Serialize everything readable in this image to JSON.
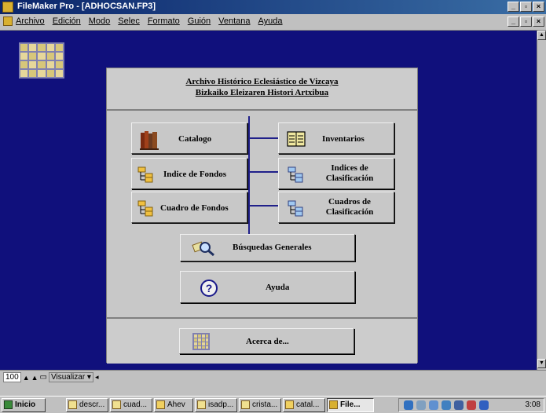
{
  "window": {
    "title": "FileMaker Pro - [ADHOCSAN.FP3]"
  },
  "menu": {
    "items": [
      "Archivo",
      "Edición",
      "Modo",
      "Selec",
      "Formato",
      "Guión",
      "Ventana",
      "Ayuda"
    ]
  },
  "header": {
    "line1": "Archivo Histórico Eclesiástico de Vizcaya",
    "line2": "Bizkaiko Eleizaren Histori Artxibua"
  },
  "buttons": {
    "catalogo": "Catalogo",
    "inventarios": "Inventarios",
    "indice_fondos": "Indice de Fondos",
    "indices_clasif_1": "Indices de",
    "indices_clasif_2": "Clasificación",
    "cuadro_fondos": "Cuadro de Fondos",
    "cuadros_clasif_1": "Cuadros de",
    "cuadros_clasif_2": "Clasificación",
    "busquedas": "Búsquedas Generales",
    "ayuda": "Ayuda",
    "acerca": "Acerca de..."
  },
  "icons": {
    "catalogo": "books-icon",
    "inventarios": "ledger-icon",
    "folders": "folder-tree-icon",
    "busquedas": "magnifier-icon",
    "ayuda": "question-mark-icon",
    "acerca": "grid-icon"
  },
  "statusbar": {
    "zoom": "100",
    "view_label": "Visualizar"
  },
  "taskbar": {
    "start": "Inicio",
    "items": [
      "descr...",
      "cuad...",
      "Ahev",
      "isadp...",
      "crista...",
      "catal...",
      "File..."
    ],
    "clock": "3:08"
  },
  "colors": {
    "background": "#10107c",
    "panel": "#c8c8c8",
    "connector": "#20208a"
  }
}
